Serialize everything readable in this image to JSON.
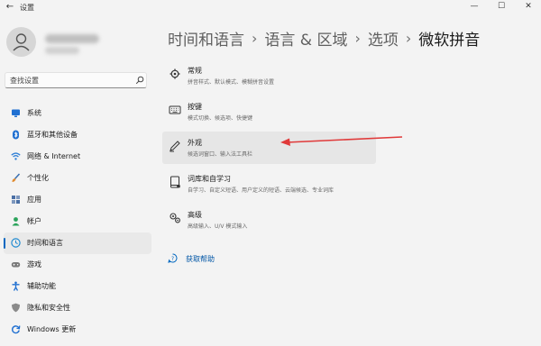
{
  "window": {
    "back_glyph": "←",
    "title": "设置",
    "minimize_glyph": "—",
    "maximize_glyph": "☐",
    "close_glyph": "✕"
  },
  "search": {
    "placeholder": "查找设置",
    "icon": "search-icon"
  },
  "sidebar": {
    "items": [
      {
        "label": "系统",
        "icon": "monitor-icon",
        "color": "#1f6fd1",
        "active": false
      },
      {
        "label": "蓝牙和其他设备",
        "icon": "bluetooth-icon",
        "color": "#1f6fd1",
        "active": false
      },
      {
        "label": "网络 & Internet",
        "icon": "wifi-icon",
        "color": "#2f7fd6",
        "active": false
      },
      {
        "label": "个性化",
        "icon": "brush-icon",
        "color": "#e08a2e",
        "active": false
      },
      {
        "label": "应用",
        "icon": "apps-icon",
        "color": "#4a6fa5",
        "active": false
      },
      {
        "label": "帐户",
        "icon": "person-icon",
        "color": "#2aa35a",
        "active": false
      },
      {
        "label": "时间和语言",
        "icon": "globe-clock-icon",
        "color": "#1f8ad1",
        "active": true
      },
      {
        "label": "游戏",
        "icon": "gamepad-icon",
        "color": "#7a7a7a",
        "active": false
      },
      {
        "label": "辅助功能",
        "icon": "accessibility-icon",
        "color": "#1f6fd1",
        "active": false
      },
      {
        "label": "隐私和安全性",
        "icon": "shield-icon",
        "color": "#8a8a8a",
        "active": false
      },
      {
        "label": "Windows 更新",
        "icon": "update-icon",
        "color": "#1f6fd1",
        "active": false
      }
    ]
  },
  "breadcrumb": {
    "items": [
      "时间和语言",
      "语言 & 区域",
      "选项",
      "微软拼音"
    ],
    "separator": "›"
  },
  "cards": [
    {
      "title": "常规",
      "desc": "拼音样式、默认模式、模糊拼音设置",
      "icon": "gear-icon",
      "highlight": false
    },
    {
      "title": "按键",
      "desc": "模式切换、候选项、快捷键",
      "icon": "keyboard-icon",
      "highlight": false
    },
    {
      "title": "外观",
      "desc": "候选词窗口、输入法工具栏",
      "icon": "pen-icon",
      "highlight": true
    },
    {
      "title": "词库和自学习",
      "desc": "自学习、自定义短语、用户定义的短语、云端候选、专业词库",
      "icon": "dictionary-icon",
      "highlight": false
    },
    {
      "title": "高级",
      "desc": "高级输入、U/V 模式输入",
      "icon": "gears-icon",
      "highlight": false
    }
  ],
  "help": {
    "label": "获取帮助",
    "icon": "help-icon"
  },
  "annotation": {
    "arrow_color": "#e03a3a"
  },
  "accent_color": "#0067c0"
}
